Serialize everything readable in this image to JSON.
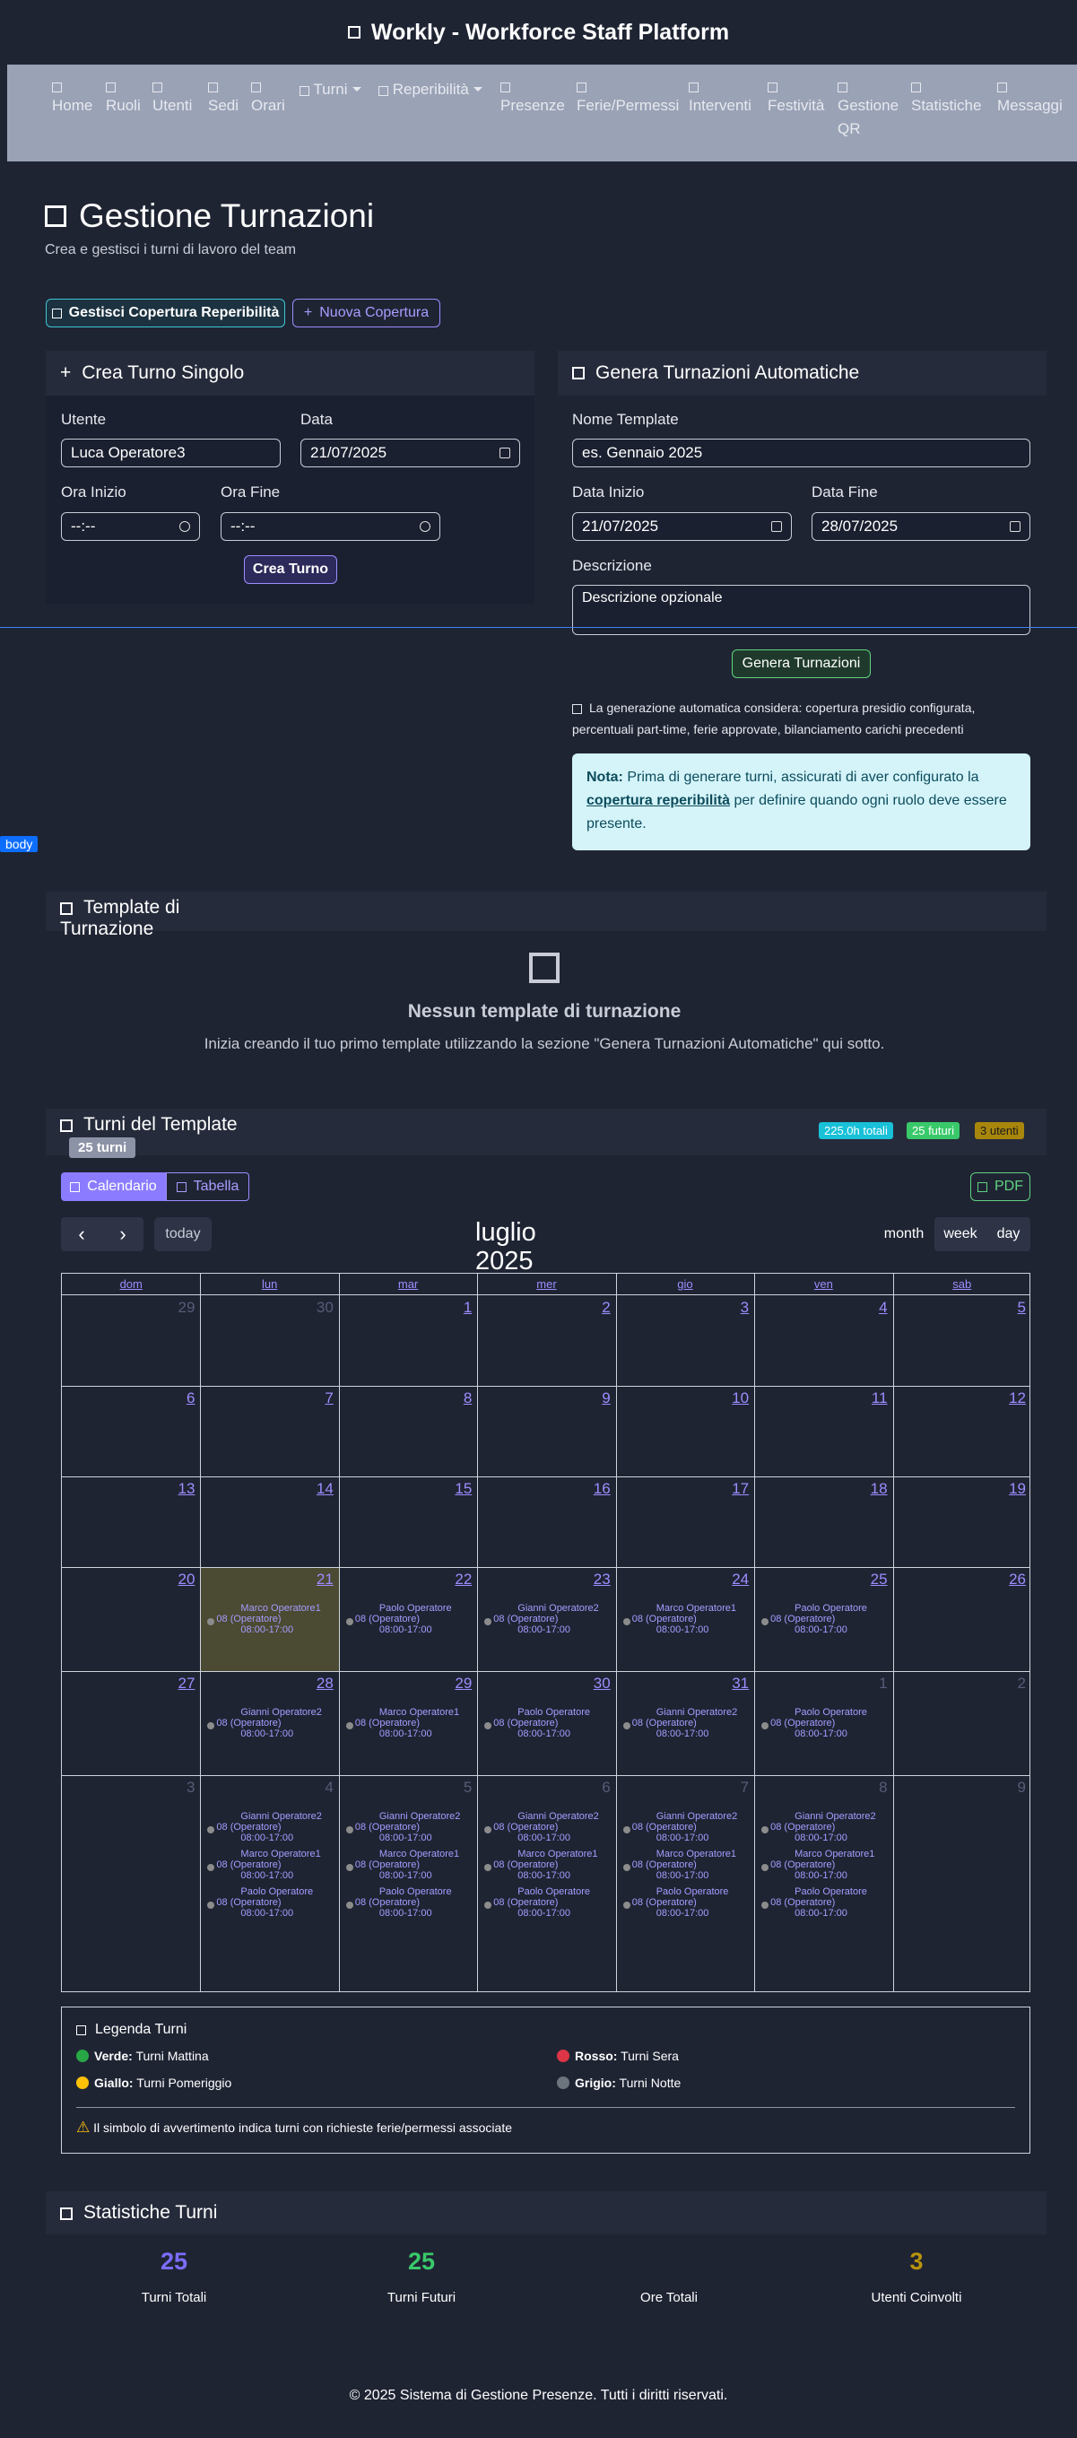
{
  "app": {
    "title": "Workly - Workforce Staff Platform",
    "body_tag": "body"
  },
  "nav": {
    "items": [
      "Home",
      "Ruoli",
      "Utenti",
      "Sedi",
      "Orari",
      "Turni",
      "Reperibilità",
      "Presenze",
      "Ferie/Permessi",
      "Interventi",
      "Festività",
      "Gestione",
      "QR",
      "Statistiche",
      "Messaggi"
    ]
  },
  "page": {
    "title": "Gestione Turnazioni",
    "subtitle": "Crea e gestisci i turni di lavoro del team"
  },
  "actions": {
    "coverage": "Gestisci Copertura Reperibilità",
    "new_coverage": "Nuova Copertura"
  },
  "single": {
    "title": "Crea Turno Singolo",
    "user_label": "Utente",
    "user_value": "Luca Operatore3",
    "date_label": "Data",
    "date_value": "21/07/2025",
    "start_label": "Ora Inizio",
    "start_value": "--:--",
    "end_label": "Ora Fine",
    "end_value": "--:--",
    "submit": "Crea Turno"
  },
  "auto": {
    "title": "Genera Turnazioni Automatiche",
    "name_label": "Nome Template",
    "name_placeholder": "es. Gennaio 2025",
    "start_label": "Data Inizio",
    "start_value": "21/07/2025",
    "end_label": "Data Fine",
    "end_value": "28/07/2025",
    "desc_label": "Descrizione",
    "desc_placeholder": "Descrizione opzionale",
    "submit": "Genera Turnazioni",
    "info": "La generazione automatica considera: copertura presidio configurata, percentuali part-time, ferie approvate, bilanciamento carichi precedenti",
    "note_bold": "Nota:",
    "note_a": "Prima di generare turni, assicurati di aver configurato la",
    "note_link": "copertura reperibilità",
    "note_b": "per definire quando ogni ruolo deve essere presente."
  },
  "templates": {
    "title_a": "Template di",
    "title_b": "Turnazione",
    "empty_title": "Nessun template di turnazione",
    "empty_text": "Inizia creando il tuo primo template utilizzando la sezione \"Genera Turnazioni Automatiche\" qui sotto."
  },
  "shifts": {
    "title": "Turni del Template",
    "count": "25 turni",
    "badge_total": "225.0h totali",
    "badge_future": "25 futuri",
    "badge_users": "3 utenti",
    "view_calendar": "Calendario",
    "view_table": "Tabella",
    "pdf": "PDF",
    "today": "today",
    "month_a": "luglio",
    "month_b": "2025",
    "month": "month",
    "week": "week",
    "day": "day"
  },
  "calendar": {
    "days": [
      "dom",
      "lun",
      "mar",
      "mer",
      "gio",
      "ven",
      "sab"
    ],
    "weeks": [
      [
        {
          "d": "29",
          "o": true
        },
        {
          "d": "30",
          "o": true
        },
        {
          "d": "1"
        },
        {
          "d": "2"
        },
        {
          "d": "3"
        },
        {
          "d": "4"
        },
        {
          "d": "5"
        }
      ],
      [
        {
          "d": "6"
        },
        {
          "d": "7"
        },
        {
          "d": "8"
        },
        {
          "d": "9"
        },
        {
          "d": "10"
        },
        {
          "d": "11"
        },
        {
          "d": "12"
        }
      ],
      [
        {
          "d": "13"
        },
        {
          "d": "14"
        },
        {
          "d": "15"
        },
        {
          "d": "16"
        },
        {
          "d": "17"
        },
        {
          "d": "18"
        },
        {
          "d": "19"
        }
      ],
      [
        {
          "d": "20"
        },
        {
          "d": "21",
          "today": true,
          "ev": [
            "Marco Operatore1"
          ]
        },
        {
          "d": "22",
          "ev": [
            "Paolo Operatore"
          ]
        },
        {
          "d": "23",
          "ev": [
            "Gianni Operatore2"
          ]
        },
        {
          "d": "24",
          "ev": [
            "Marco Operatore1"
          ]
        },
        {
          "d": "25",
          "ev": [
            "Paolo Operatore"
          ]
        },
        {
          "d": "26"
        }
      ],
      [
        {
          "d": "27"
        },
        {
          "d": "28",
          "ev": [
            "Gianni Operatore2"
          ]
        },
        {
          "d": "29",
          "ev": [
            "Marco Operatore1"
          ]
        },
        {
          "d": "30",
          "ev": [
            "Paolo Operatore"
          ]
        },
        {
          "d": "31",
          "ev": [
            "Gianni Operatore2"
          ]
        },
        {
          "d": "1",
          "o": true,
          "ev": [
            "Paolo Operatore"
          ]
        },
        {
          "d": "2",
          "o": true
        }
      ],
      [
        {
          "d": "3",
          "o": true
        },
        {
          "d": "4",
          "o": true,
          "ev": [
            "Gianni Operatore2",
            "Marco Operatore1",
            "Paolo Operatore"
          ]
        },
        {
          "d": "5",
          "o": true,
          "ev": [
            "Gianni Operatore2",
            "Marco Operatore1",
            "Paolo Operatore"
          ]
        },
        {
          "d": "6",
          "o": true,
          "ev": [
            "Gianni Operatore2",
            "Marco Operatore1",
            "Paolo Operatore"
          ]
        },
        {
          "d": "7",
          "o": true,
          "ev": [
            "Gianni Operatore2",
            "Marco Operatore1",
            "Paolo Operatore"
          ]
        },
        {
          "d": "8",
          "o": true,
          "ev": [
            "Gianni Operatore2",
            "Marco Operatore1",
            "Paolo Operatore"
          ]
        },
        {
          "d": "9",
          "o": true
        }
      ]
    ],
    "event_type": "08 (Operatore)",
    "event_hours": "08:00-17:00"
  },
  "legend": {
    "title": "Legenda Turni",
    "green_b": "Verde:",
    "green": "Turni Mattina",
    "yellow_b": "Giallo:",
    "yellow": "Turni Pomeriggio",
    "red_b": "Rosso:",
    "red": "Turni Sera",
    "grey_b": "Grigio:",
    "grey": "Turni Notte",
    "warning": "Il simbolo di avvertimento indica turni con richieste ferie/permessi associate",
    "colors": {
      "green": "#28a745",
      "yellow": "#ffc107",
      "red": "#dc3545",
      "grey": "#6c757d"
    }
  },
  "stats": {
    "title": "Statistiche Turni",
    "total_v": "25",
    "total_l": "Turni Totali",
    "future_v": "25",
    "future_l": "Turni Futuri",
    "hours_v": "",
    "hours_l": "Ore Totali",
    "users_v": "3",
    "users_l": "Utenti Coinvolti"
  },
  "footer": {
    "text": "© 2025 Sistema di Gestione Presenze. Tutti i diritti riservati."
  }
}
